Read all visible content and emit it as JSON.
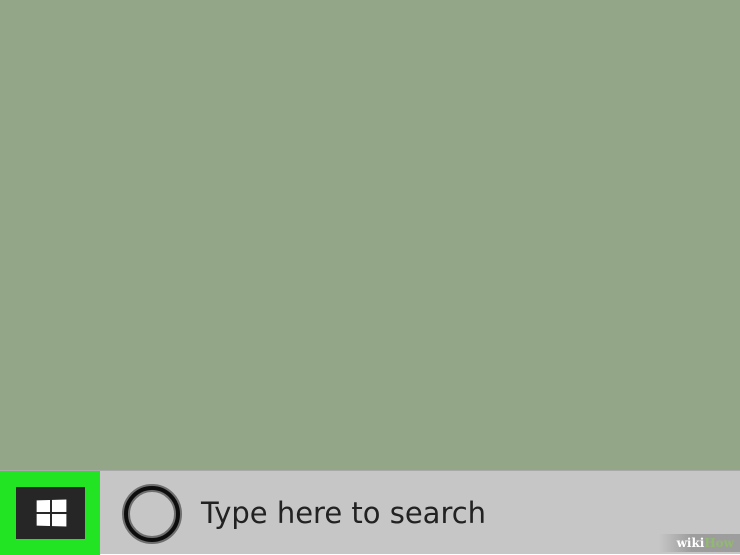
{
  "colors": {
    "desktop_background": "#93a687",
    "taskbar_background": "#c6c6c6",
    "start_highlight": "#22e422",
    "start_button": "#262626",
    "cortana_ring_outer": "#6f6f6f",
    "cortana_ring_inner": "#0d0d0d"
  },
  "start": {
    "icon": "windows-logo-icon"
  },
  "search": {
    "icon": "cortana-circle-icon",
    "placeholder": "Type here to search"
  },
  "watermark": {
    "prefix": "wiki",
    "suffix": "How"
  }
}
